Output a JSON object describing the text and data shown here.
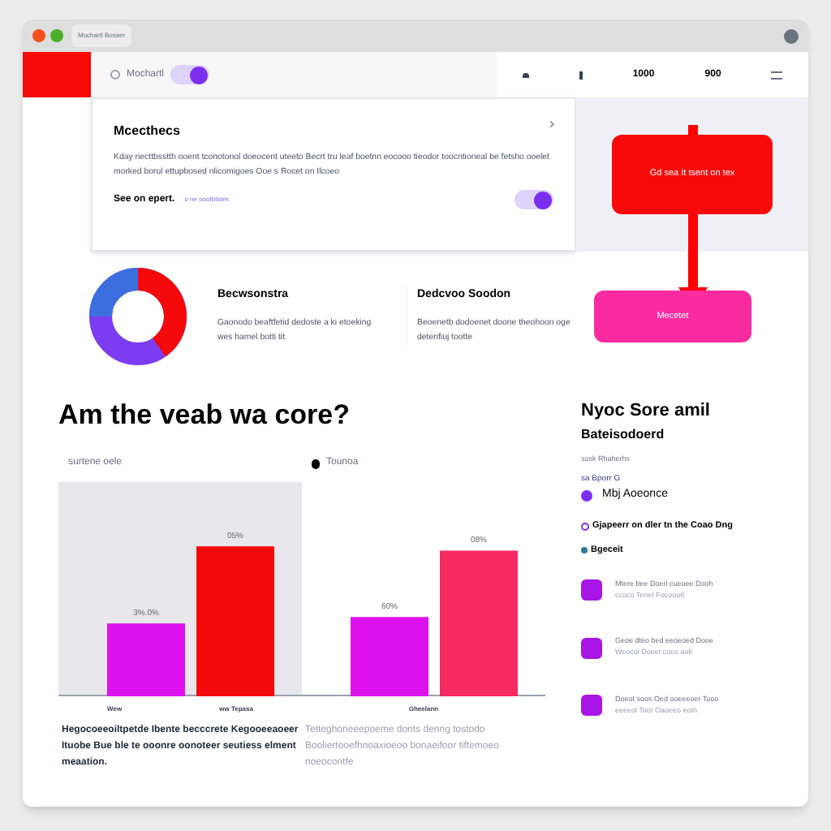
{
  "browser": {
    "tab_title": "Mochartl Bosaer"
  },
  "nav": {
    "search_label": "Mochartl",
    "toggle_on": true,
    "items": [
      "1000",
      "900"
    ]
  },
  "hero": {
    "title": "Mcecthecs",
    "body": "Kday riecttbsstth ooent tconotonol doeocent uteeto Becrt tru leaf boetnn eocooo tieodor toocntioneal be fetsho ooelet morked borul ettupbosed nlicomigoes Ooe s Rocet on Ilcoeo",
    "link_label": "See on epert.",
    "link_note": "o ne oootbtstes",
    "toggle_on": true
  },
  "callout_button": "Gd sea It tsent on tex",
  "summaries": [
    {
      "title": "Becwsonstra",
      "body": "Gaonodo beaftfetid dedoste a ki etoeking wes hamel botti tit"
    },
    {
      "title": "Dedcvoo Soodon",
      "body": "Beoenetb dodoenet doone theohoon oge detenfiuj tootte"
    }
  ],
  "action_button": "Mecetet",
  "headline": "Am the veab wa core?",
  "charts": [
    {
      "subtitle": "surtene oele",
      "shaded": true,
      "axis_labels": [
        "Wew",
        "ww Tepasa"
      ],
      "caption": "Hegocoeeoiltpetde Ibente becccrete Kegooeeaoeer Ituobe Bue ble te ooonre oonoteer seutiess elment meaation.",
      "bar_labels": [
        "3%.0%",
        "05%"
      ]
    },
    {
      "subtitle": "Tounoa",
      "shaded": false,
      "axis_labels": [
        "Gheelann"
      ],
      "caption": "Tetteghoneeepoeme donts denng tostodo Booliertooefhnoaxioeoo bonaeifoor tiftemoeo noeocontfe",
      "bar_labels": [
        "60%",
        "08%"
      ]
    }
  ],
  "side": {
    "title": "Nyoc Sore amil",
    "subtitle": "Bateisodoerd",
    "note": "sosk Rhaherhs",
    "tag": "sa Bporr G",
    "highlight": "Mbj Aoeonce",
    "line": "Gjapeerr on dler tn the Coao Dng",
    "badge": "Bgeceit",
    "items": [
      {
        "title": "Mtere bee Doerl cueoee Dooh",
        "sub": "ccoco Tenet Focoootl"
      },
      {
        "title": "Geoe dteo bed eeoeoed Dooe",
        "sub": "Weocol Doeet coos aolt"
      },
      {
        "title": "Doeot soos Oed ooeeeoer Tooo",
        "sub": "eeeeol Toot Oaoeeo eotn"
      }
    ]
  }
}
